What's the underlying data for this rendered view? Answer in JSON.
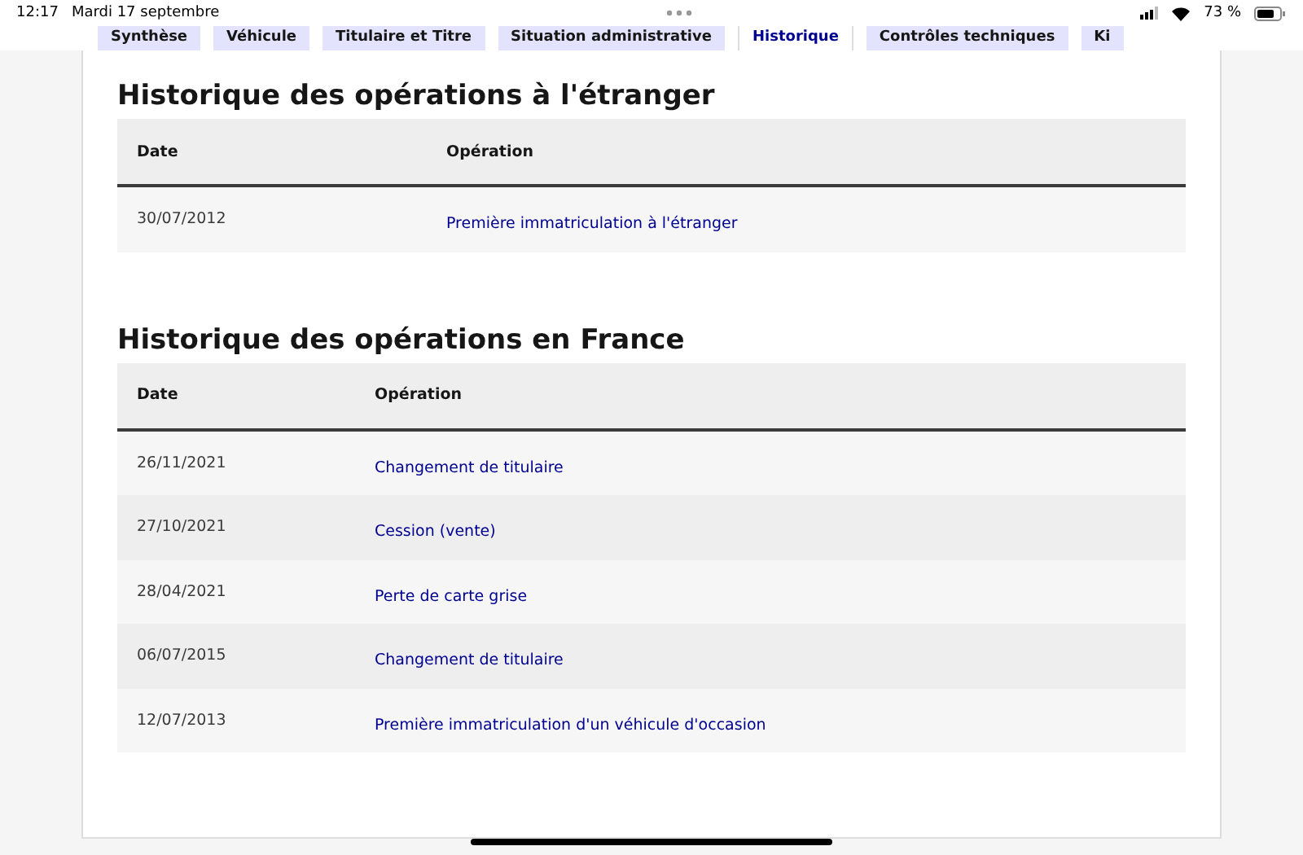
{
  "status_bar": {
    "time": "12:17",
    "date": "Mardi 17 septembre",
    "battery": "73 %"
  },
  "tabs": [
    {
      "label": "Synthèse",
      "selected": false
    },
    {
      "label": "Véhicule",
      "selected": false
    },
    {
      "label": "Titulaire et Titre",
      "selected": false
    },
    {
      "label": "Situation administrative",
      "selected": false
    },
    {
      "label": "Historique",
      "selected": true
    },
    {
      "label": "Contrôles techniques",
      "selected": false
    },
    {
      "label": "Ki",
      "selected": false
    }
  ],
  "sections": [
    {
      "title": "Historique des opérations à l'étranger",
      "columns": [
        "Date",
        "Opération"
      ],
      "rows": [
        {
          "date": "30/07/2012",
          "operation": "Première immatriculation à l'étranger"
        }
      ]
    },
    {
      "title": "Historique des opérations en France",
      "columns": [
        "Date",
        "Opération"
      ],
      "rows": [
        {
          "date": "26/11/2021",
          "operation": "Changement de titulaire"
        },
        {
          "date": "27/10/2021",
          "operation": "Cession (vente)"
        },
        {
          "date": "28/04/2021",
          "operation": "Perte de carte grise"
        },
        {
          "date": "06/07/2015",
          "operation": "Changement de titulaire"
        },
        {
          "date": "12/07/2013",
          "operation": "Première immatriculation d'un véhicule d'occasion"
        }
      ]
    }
  ]
}
